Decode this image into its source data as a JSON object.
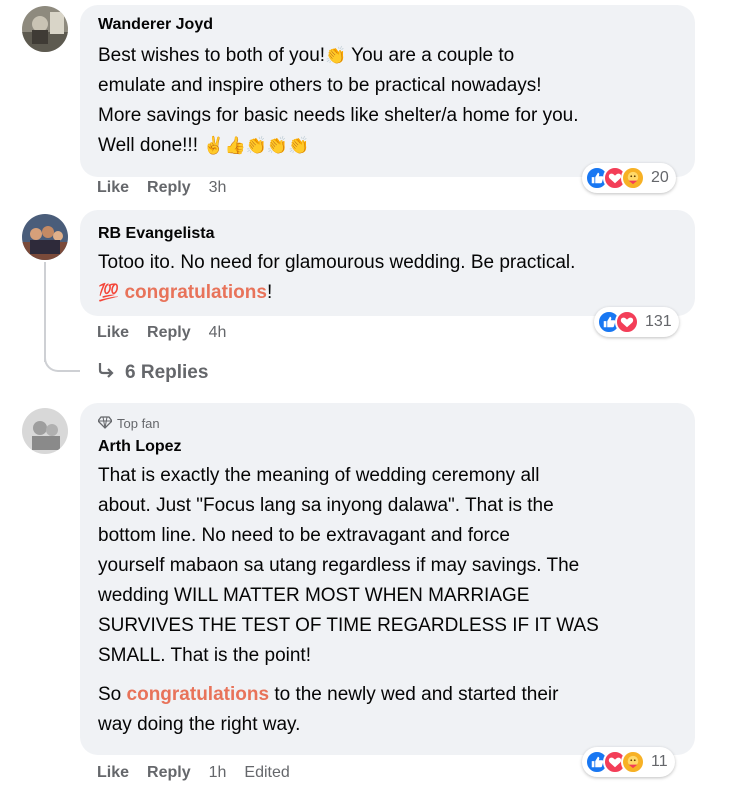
{
  "comments": [
    {
      "author": "Wanderer Joyd",
      "text": "Best wishes to both of you! You are a couple to emulate and inspire others to be practical nowadays! More savings for basic needs like shelter/a home for you. Well done!!!",
      "line1": "Best wishes to both of you!",
      "line1b": " You are a couple to",
      "line2": "emulate and inspire others to be practical nowadays!",
      "line3": "More savings for basic needs like shelter/a home for you.",
      "line4": "Well done!!!",
      "actions": {
        "like": "Like",
        "reply": "Reply",
        "time": "3h"
      },
      "reaction_count": "20",
      "reaction_icons": [
        "like-icon",
        "love-icon",
        "care-icon"
      ]
    },
    {
      "author": "RB Evangelista",
      "line1": "Totoo ito. No need for glamourous wedding. Be practical.",
      "highlight": "congratulations",
      "after_highlight": "!",
      "emoji": "💯",
      "actions": {
        "like": "Like",
        "reply": "Reply",
        "time": "4h"
      },
      "reaction_count": "131",
      "reaction_icons": [
        "like-icon",
        "love-icon"
      ],
      "replies_label": "6 Replies"
    },
    {
      "badge": "Top fan",
      "author": "Arth Lopez",
      "p1": [
        "That is exactly the meaning of wedding ceremony all",
        "about. Just \"Focus lang sa inyong dalawa\". That is the",
        "bottom line. No need to be extravagant and force",
        "yourself mabaon sa utang regardless if may savings. The",
        "wedding WILL MATTER MOST WHEN MARRIAGE",
        "SURVIVES THE TEST OF TIME REGARDLESS IF IT WAS",
        "SMALL. That is the point!"
      ],
      "p2_before": "So ",
      "p2_highlight": "congratulations",
      "p2_after": " to the newly wed and started their",
      "p2_line2": "way doing the right way.",
      "actions": {
        "like": "Like",
        "reply": "Reply",
        "time": "1h",
        "edited": "Edited"
      },
      "reaction_count": "11",
      "reaction_icons": [
        "like-icon",
        "love-icon",
        "care-icon"
      ]
    }
  ],
  "colors": {
    "bubble": "#f0f2f5",
    "meta": "#65676b",
    "highlight": "#e8735a",
    "like": "#1877f2",
    "love": "#f33e58",
    "care": "#f7b125"
  }
}
